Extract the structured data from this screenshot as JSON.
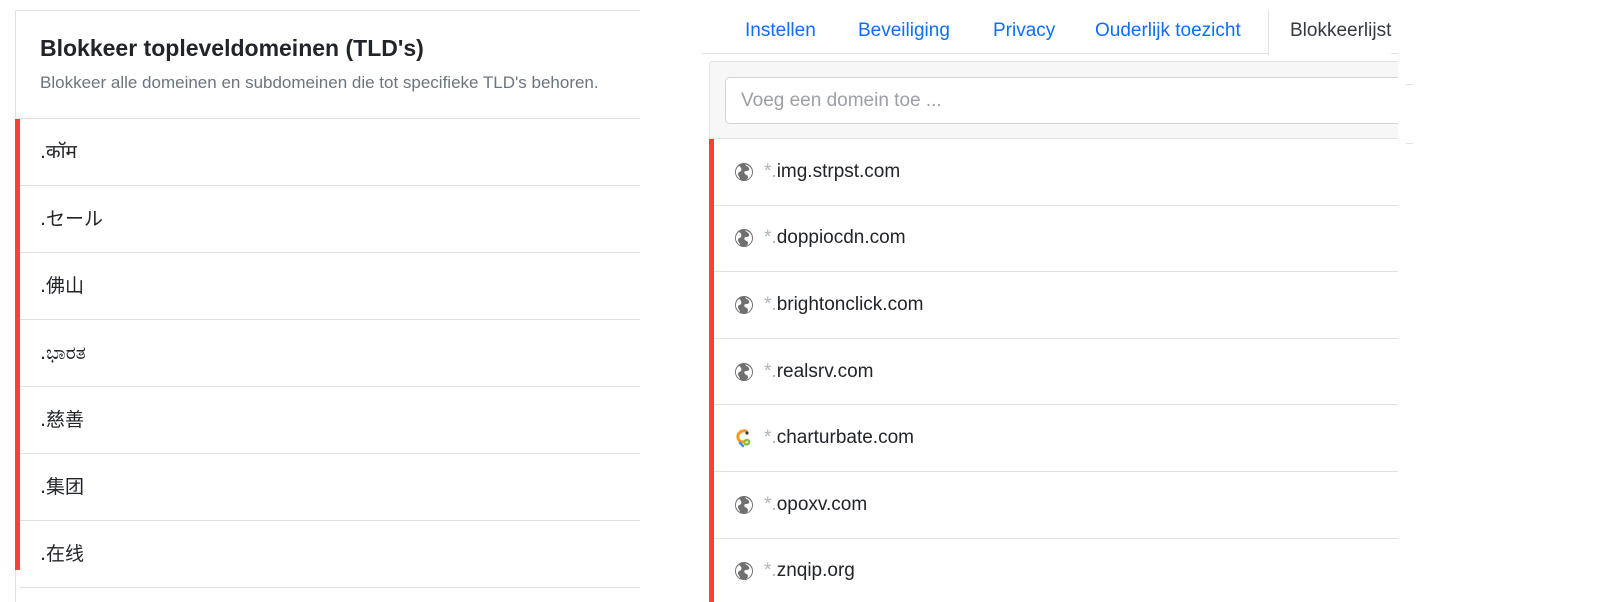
{
  "left": {
    "title": "Blokkeer topleveldomeinen (TLD's)",
    "subtitle": "Blokkeer alle domeinen en subdomeinen die tot specifieke TLD's behoren.",
    "tlds": [
      ".कॉम",
      ".セール",
      ".佛山",
      ".ಭಾರತ",
      ".慈善",
      ".集团",
      ".在线"
    ],
    "accent_color": "#f44336"
  },
  "tabs": [
    {
      "label": "Instellen"
    },
    {
      "label": "Beveiliging"
    },
    {
      "label": "Privacy"
    },
    {
      "label": "Ouderlijk toezicht"
    },
    {
      "label": "Blokkeerlijst"
    }
  ],
  "active_tab": "Blokkeerlijst",
  "input": {
    "placeholder": "Voeg een domein toe ...",
    "value": ""
  },
  "domains": [
    {
      "wildcard": "*.",
      "name": "img.strpst.com",
      "icon": "globe-icon"
    },
    {
      "wildcard": "*.",
      "name": "doppiocdn.com",
      "icon": "globe-icon"
    },
    {
      "wildcard": "*.",
      "name": "brightonclick.com",
      "icon": "globe-icon"
    },
    {
      "wildcard": "*.",
      "name": "realsrv.com",
      "icon": "globe-icon"
    },
    {
      "wildcard": "*.",
      "name": "charturbate.com",
      "icon": "chaturbate-favicon-icon"
    },
    {
      "wildcard": "*.",
      "name": "opoxv.com",
      "icon": "globe-icon"
    },
    {
      "wildcard": "*.",
      "name": "znqip.org",
      "icon": "globe-icon"
    }
  ],
  "colors": {
    "link": "#0d6efd",
    "block_accent": "#f44336",
    "muted": "#6c757d"
  }
}
